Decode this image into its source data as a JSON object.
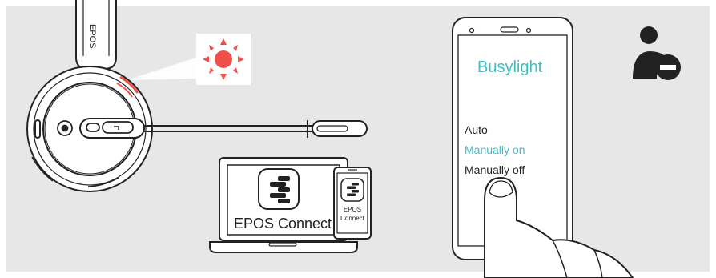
{
  "headset": {
    "brand_text": "EPOS"
  },
  "epos_connect": {
    "laptop_label": "EPOS Connect",
    "phone_label_line1": "EPOS",
    "phone_label_line2": "Connect"
  },
  "phone_app": {
    "title": "Busylight",
    "options": [
      "Auto",
      "Manually on",
      "Manually off"
    ],
    "selected_index": 1
  },
  "colors": {
    "background": "#e7e7e8",
    "busylight_red": "#f0504a",
    "accent_teal": "#3dbdc6",
    "line": "#222222"
  },
  "icons": [
    "busylight-icon",
    "epos-connect-logo-icon",
    "user-busy-icon",
    "finger-icon"
  ]
}
